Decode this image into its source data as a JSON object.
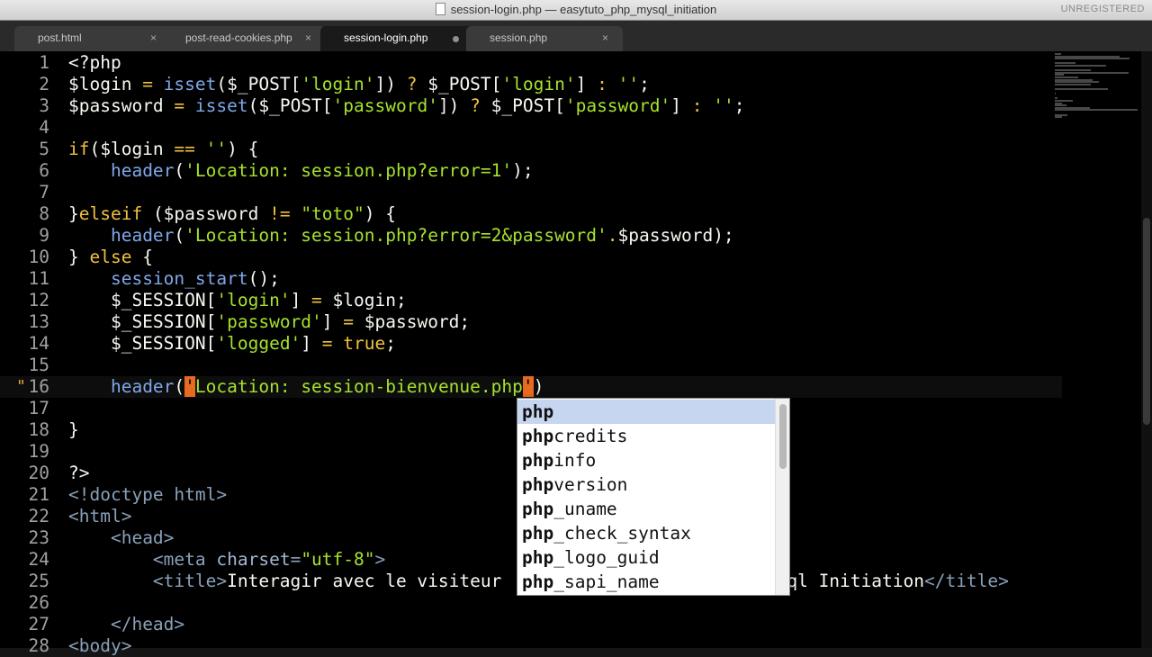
{
  "window": {
    "title": "session-login.php — easytuto_php_mysql_initiation",
    "badge": "UNREGISTERED"
  },
  "tabs": [
    {
      "label": "post.html",
      "state": "close"
    },
    {
      "label": "post-read-cookies.php",
      "state": "close"
    },
    {
      "label": "session-login.php",
      "state": "dirty"
    },
    {
      "label": "session.php",
      "state": "close"
    }
  ],
  "tab_close_glyph": "×",
  "gutter_marker": "\"",
  "current_line": 16,
  "lines": [
    {
      "n": "1",
      "segs": [
        {
          "t": "<?php",
          "c": "var"
        }
      ]
    },
    {
      "n": "2",
      "segs": [
        {
          "t": "$login ",
          "c": "var"
        },
        {
          "t": "=",
          "c": "kw"
        },
        {
          "t": " ",
          "c": "var"
        },
        {
          "t": "isset",
          "c": "fn"
        },
        {
          "t": "($_POST[",
          "c": "var"
        },
        {
          "t": "'login'",
          "c": "str"
        },
        {
          "t": "]) ",
          "c": "var"
        },
        {
          "t": "?",
          "c": "kw"
        },
        {
          "t": " $_POST[",
          "c": "var"
        },
        {
          "t": "'login'",
          "c": "str"
        },
        {
          "t": "] ",
          "c": "var"
        },
        {
          "t": ":",
          "c": "kw"
        },
        {
          "t": " ",
          "c": "var"
        },
        {
          "t": "''",
          "c": "str"
        },
        {
          "t": ";",
          "c": "var"
        }
      ]
    },
    {
      "n": "3",
      "segs": [
        {
          "t": "$password ",
          "c": "var"
        },
        {
          "t": "=",
          "c": "kw"
        },
        {
          "t": " ",
          "c": "var"
        },
        {
          "t": "isset",
          "c": "fn"
        },
        {
          "t": "($_POST[",
          "c": "var"
        },
        {
          "t": "'password'",
          "c": "str"
        },
        {
          "t": "]) ",
          "c": "var"
        },
        {
          "t": "?",
          "c": "kw"
        },
        {
          "t": " $_POST[",
          "c": "var"
        },
        {
          "t": "'password'",
          "c": "str"
        },
        {
          "t": "] ",
          "c": "var"
        },
        {
          "t": ":",
          "c": "kw"
        },
        {
          "t": " ",
          "c": "var"
        },
        {
          "t": "''",
          "c": "str"
        },
        {
          "t": ";",
          "c": "var"
        }
      ]
    },
    {
      "n": "4",
      "segs": []
    },
    {
      "n": "5",
      "segs": [
        {
          "t": "if",
          "c": "kw"
        },
        {
          "t": "($login ",
          "c": "var"
        },
        {
          "t": "==",
          "c": "kw"
        },
        {
          "t": " ",
          "c": "var"
        },
        {
          "t": "''",
          "c": "str"
        },
        {
          "t": ") {",
          "c": "var"
        }
      ]
    },
    {
      "n": "6",
      "segs": [
        {
          "t": "    ",
          "c": "var"
        },
        {
          "t": "header",
          "c": "fn"
        },
        {
          "t": "(",
          "c": "var"
        },
        {
          "t": "'Location: session.php?error=1'",
          "c": "str"
        },
        {
          "t": ");",
          "c": "var"
        }
      ]
    },
    {
      "n": "7",
      "segs": []
    },
    {
      "n": "8",
      "segs": [
        {
          "t": "}",
          "c": "var"
        },
        {
          "t": "elseif",
          "c": "kw"
        },
        {
          "t": " ($password ",
          "c": "var"
        },
        {
          "t": "!=",
          "c": "kw"
        },
        {
          "t": " ",
          "c": "var"
        },
        {
          "t": "\"toto\"",
          "c": "str"
        },
        {
          "t": ") {",
          "c": "var"
        }
      ]
    },
    {
      "n": "9",
      "segs": [
        {
          "t": "    ",
          "c": "var"
        },
        {
          "t": "header",
          "c": "fn"
        },
        {
          "t": "(",
          "c": "var"
        },
        {
          "t": "'Location: session.php?error=2&password'",
          "c": "str"
        },
        {
          "t": ".",
          "c": "kw"
        },
        {
          "t": "$password);",
          "c": "var"
        }
      ]
    },
    {
      "n": "10",
      "segs": [
        {
          "t": "} ",
          "c": "var"
        },
        {
          "t": "else",
          "c": "kw"
        },
        {
          "t": " {",
          "c": "var"
        }
      ]
    },
    {
      "n": "11",
      "segs": [
        {
          "t": "    ",
          "c": "var"
        },
        {
          "t": "session_start",
          "c": "fn"
        },
        {
          "t": "();",
          "c": "var"
        }
      ]
    },
    {
      "n": "12",
      "segs": [
        {
          "t": "    $_SESSION[",
          "c": "var"
        },
        {
          "t": "'login'",
          "c": "str"
        },
        {
          "t": "] ",
          "c": "var"
        },
        {
          "t": "=",
          "c": "kw"
        },
        {
          "t": " $login;",
          "c": "var"
        }
      ]
    },
    {
      "n": "13",
      "segs": [
        {
          "t": "    $_SESSION[",
          "c": "var"
        },
        {
          "t": "'password'",
          "c": "str"
        },
        {
          "t": "] ",
          "c": "var"
        },
        {
          "t": "=",
          "c": "kw"
        },
        {
          "t": " $password;",
          "c": "var"
        }
      ]
    },
    {
      "n": "14",
      "segs": [
        {
          "t": "    $_SESSION[",
          "c": "var"
        },
        {
          "t": "'logged'",
          "c": "str"
        },
        {
          "t": "] ",
          "c": "var"
        },
        {
          "t": "=",
          "c": "kw"
        },
        {
          "t": " ",
          "c": "var"
        },
        {
          "t": "true",
          "c": "kw"
        },
        {
          "t": ";",
          "c": "var"
        }
      ]
    },
    {
      "n": "15",
      "segs": []
    },
    {
      "n": "16",
      "segs": [
        {
          "t": "    ",
          "c": "var"
        },
        {
          "t": "header",
          "c": "fn"
        },
        {
          "t": "(",
          "c": "var"
        },
        {
          "t": "'",
          "c": "caret"
        },
        {
          "t": "Location: session-bienvenue.php",
          "c": "str"
        },
        {
          "t": "'",
          "c": "caret"
        },
        {
          "t": ")",
          "c": "var"
        }
      ]
    },
    {
      "n": "17",
      "segs": []
    },
    {
      "n": "18",
      "segs": [
        {
          "t": "}",
          "c": "var"
        }
      ]
    },
    {
      "n": "19",
      "segs": []
    },
    {
      "n": "20",
      "segs": [
        {
          "t": "?>",
          "c": "var"
        }
      ]
    },
    {
      "n": "21",
      "segs": [
        {
          "t": "<!doctype html>",
          "c": "tag"
        }
      ]
    },
    {
      "n": "22",
      "segs": [
        {
          "t": "<html>",
          "c": "tag"
        }
      ]
    },
    {
      "n": "23",
      "segs": [
        {
          "t": "    ",
          "c": "var"
        },
        {
          "t": "<head>",
          "c": "tag"
        }
      ]
    },
    {
      "n": "24",
      "segs": [
        {
          "t": "        ",
          "c": "var"
        },
        {
          "t": "<meta ",
          "c": "tag"
        },
        {
          "t": "charset",
          "c": "attr"
        },
        {
          "t": "=",
          "c": "tag"
        },
        {
          "t": "\"utf-8\"",
          "c": "str"
        },
        {
          "t": ">",
          "c": "tag"
        }
      ]
    },
    {
      "n": "25",
      "segs": [
        {
          "t": "        ",
          "c": "var"
        },
        {
          "t": "<title>",
          "c": "tag"
        },
        {
          "t": "Interagir avec le visiteur",
          "c": "var"
        },
        {
          "t": "                           ",
          "c": "var"
        },
        {
          "t": "ql Initiation",
          "c": "var"
        },
        {
          "t": "</title>",
          "c": "tag"
        }
      ]
    },
    {
      "n": "26",
      "segs": []
    },
    {
      "n": "27",
      "segs": [
        {
          "t": "    ",
          "c": "var"
        },
        {
          "t": "</head>",
          "c": "tag"
        }
      ]
    },
    {
      "n": "28",
      "segs": [
        {
          "t": "<body>",
          "c": "tag"
        }
      ]
    }
  ],
  "autocomplete": {
    "prefix": "php",
    "items": [
      "php",
      "phpcredits",
      "phpinfo",
      "phpversion",
      "php_uname",
      "php_check_syntax",
      "php_logo_guid",
      "php_sapi_name"
    ],
    "selected_index": 0
  }
}
